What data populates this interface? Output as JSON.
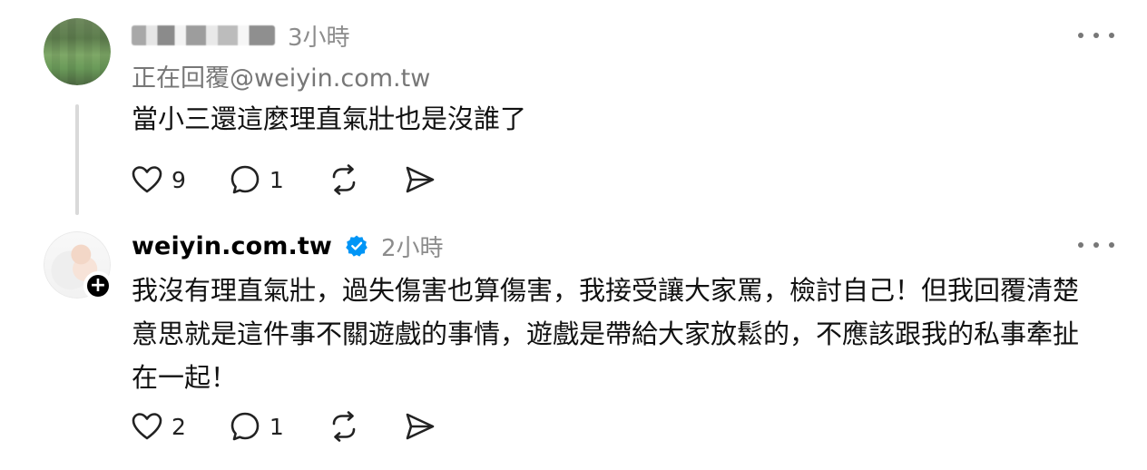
{
  "posts": [
    {
      "username": "",
      "username_blurred": true,
      "timestamp": "3小時",
      "replying_to": "正在回覆@weiyin.com.tw",
      "text": "當小三還這麼理直氣壯也是沒誰了",
      "likes": "9",
      "comments": "1"
    },
    {
      "username": "weiyin.com.tw",
      "verified": true,
      "timestamp": "2小時",
      "text_lines": [
        "我沒有理直氣壯，過失傷害也算傷害，我接受讓大家罵，檢討自己！但我回覆清楚",
        "意思就是這件事不關遊戲的事情，遊戲是帶給大家放鬆的，不應該跟我的私事牽扯",
        "在一起！"
      ],
      "likes": "2",
      "comments": "1"
    }
  ],
  "icons": {
    "like": "heart-icon",
    "comment": "comment-bubble-icon",
    "repost": "repost-icon",
    "share": "send-icon",
    "more": "more-dots-icon",
    "verified": "verified-badge-icon",
    "follow": "plus-icon"
  },
  "colors": {
    "verified_blue": "#0095f6",
    "muted_text": "#8c8c8c",
    "thread_line": "#d9d9d9"
  }
}
